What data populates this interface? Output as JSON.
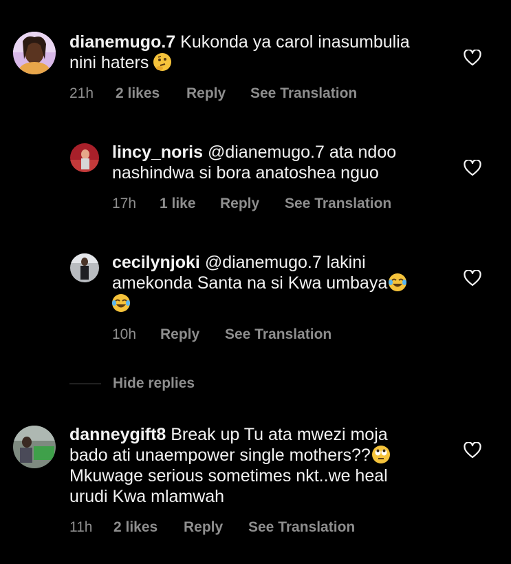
{
  "comments": [
    {
      "username": "dianemugo.7",
      "text_lines": [
        "Kukonda ya carol inasumbulia",
        "nini haters"
      ],
      "time": "21h",
      "likes": "2 likes",
      "reply": "Reply",
      "translate": "See Translation",
      "emoji": "thinking-face"
    },
    {
      "username": "lincy_noris",
      "text_lines": [
        "@dianemugo.7 ata ndoo",
        "nashindwa si bora anatoshea nguo"
      ],
      "time": "17h",
      "likes": "1 like",
      "reply": "Reply",
      "translate": "See Translation"
    },
    {
      "username": "cecilynjoki",
      "text_lines": [
        "@dianemugo.7 lakini",
        "amekonda Santa na si Kwa umbaya"
      ],
      "time": "10h",
      "reply": "Reply",
      "translate": "See Translation",
      "emoji": "tears-of-joy-face"
    },
    {
      "username": "danneygift8",
      "text_lines": [
        "Break up Tu ata mwezi moja",
        "bado ati unaempower single mothers??",
        "Mkuwage serious sometimes nkt..we heal",
        "urudi Kwa mlamwah"
      ],
      "time": "11h",
      "likes": "2 likes",
      "reply": "Reply",
      "translate": "See Translation",
      "emoji": "rolling-eyes-face"
    }
  ],
  "hide_replies": "Hide replies",
  "colors": {
    "background": "#000000",
    "text": "#f2f2f2",
    "muted": "#8e8e8e"
  }
}
